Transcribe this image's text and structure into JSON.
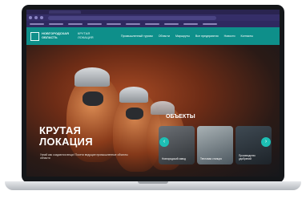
{
  "site": {
    "logo_text": "Новгородская область",
    "brand_text": "Крутая локация",
    "nav": [
      "Промышленный туризм",
      "Области",
      "Маршруты",
      "Все предприятия",
      "Новости",
      "Контакты"
    ],
    "hero": {
      "title_line1": "КРУТАЯ",
      "title_line2": "ЛОКАЦИЯ",
      "subtitle": "Узнай как создаются вещи! Посети ведущие промышленные объекты области"
    },
    "objects": {
      "heading": "ОБЪЕКТЫ",
      "cards": [
        "Новгородский завод",
        "Тепловая станция",
        "Производство удобрений"
      ]
    },
    "colors": {
      "nav": "#0e8f8a",
      "accent": "#1dbfb4"
    }
  },
  "icons": {
    "left_arrow": "arrow-left-icon",
    "right_arrow": "arrow-right-icon"
  }
}
